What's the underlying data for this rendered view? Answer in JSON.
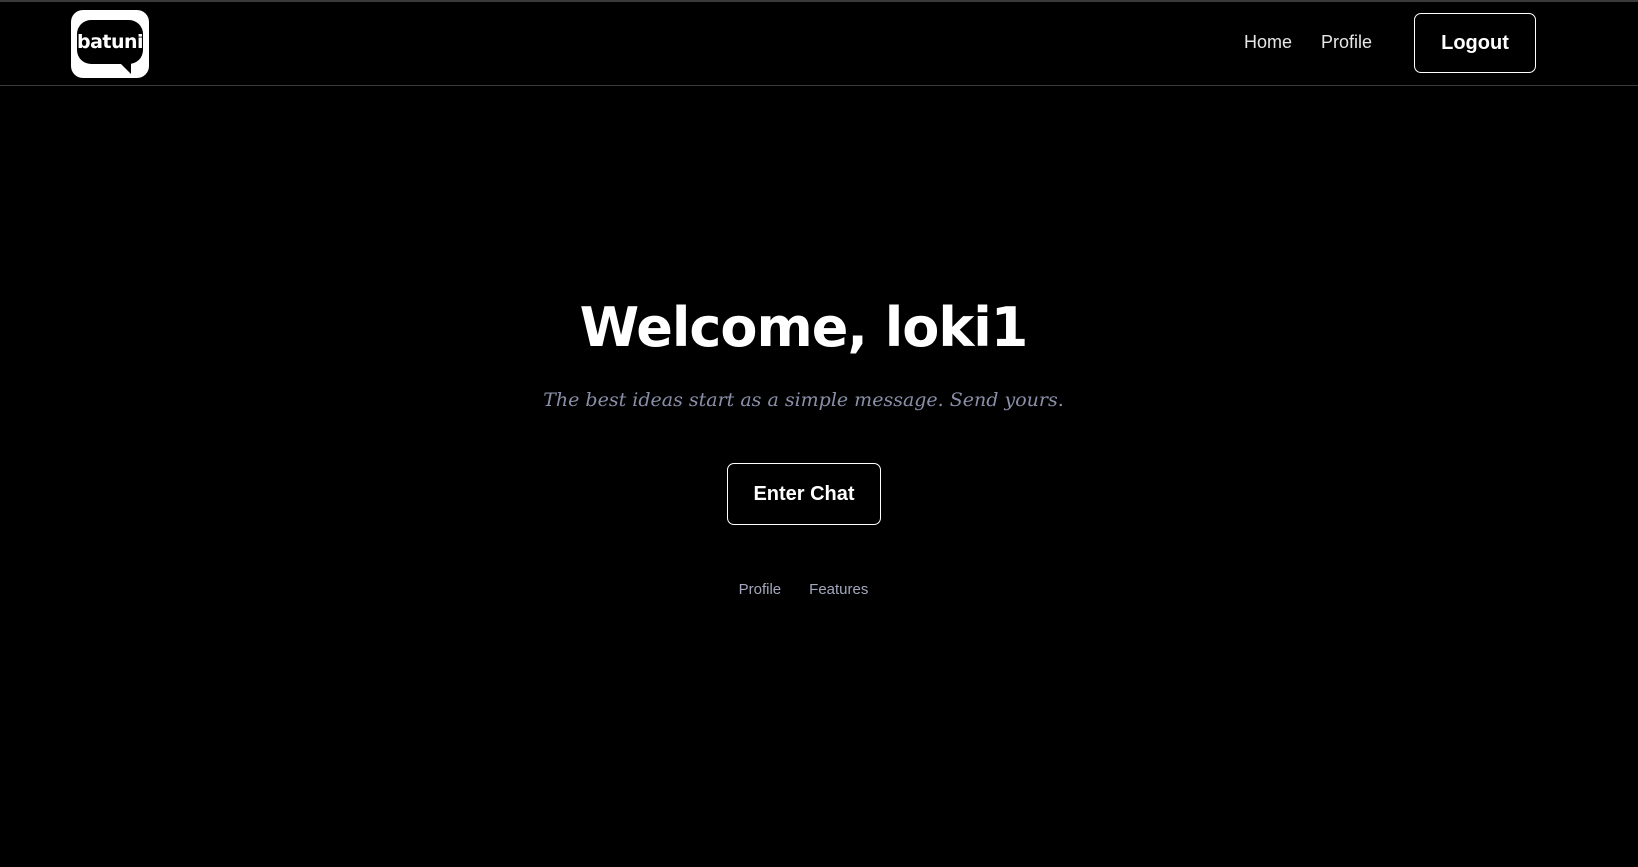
{
  "header": {
    "logo_text": "batuni",
    "nav": {
      "home_label": "Home",
      "profile_label": "Profile"
    },
    "logout_label": "Logout"
  },
  "hero": {
    "title": "Welcome, loki1",
    "subtitle": "The best ideas start as a simple message. Send yours.",
    "cta_label": "Enter Chat"
  },
  "footer_links": {
    "profile_label": "Profile",
    "features_label": "Features"
  },
  "colors": {
    "background": "#000000",
    "text": "#ffffff",
    "subtitle": "#8a8fa8",
    "footer_link": "#a3a7bd",
    "border": "#3a3a3a"
  },
  "icons": {
    "logo": "speech-bubble-logo"
  }
}
